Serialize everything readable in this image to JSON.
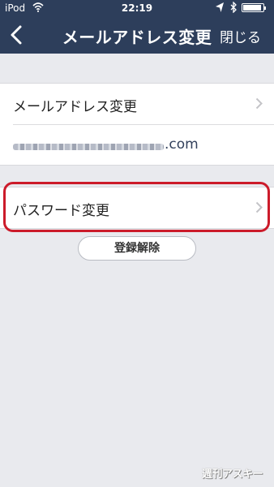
{
  "status_bar": {
    "carrier": "iPod",
    "time": "22:19",
    "battery_level": 0.9
  },
  "nav": {
    "title": "メールアドレス変更",
    "close_label": "閉じる",
    "back_icon": "chevron-left-icon"
  },
  "email_section": {
    "change_label": "メールアドレス変更",
    "email_domain_suffix": ".com"
  },
  "password_section": {
    "change_label": "パスワード変更"
  },
  "unregister_label": "登録解除",
  "watermark": "週刊アスキー",
  "colors": {
    "nav_background": "#2d3e5b",
    "highlight_border": "#cc1b2a",
    "page_background": "#e9eaee"
  }
}
